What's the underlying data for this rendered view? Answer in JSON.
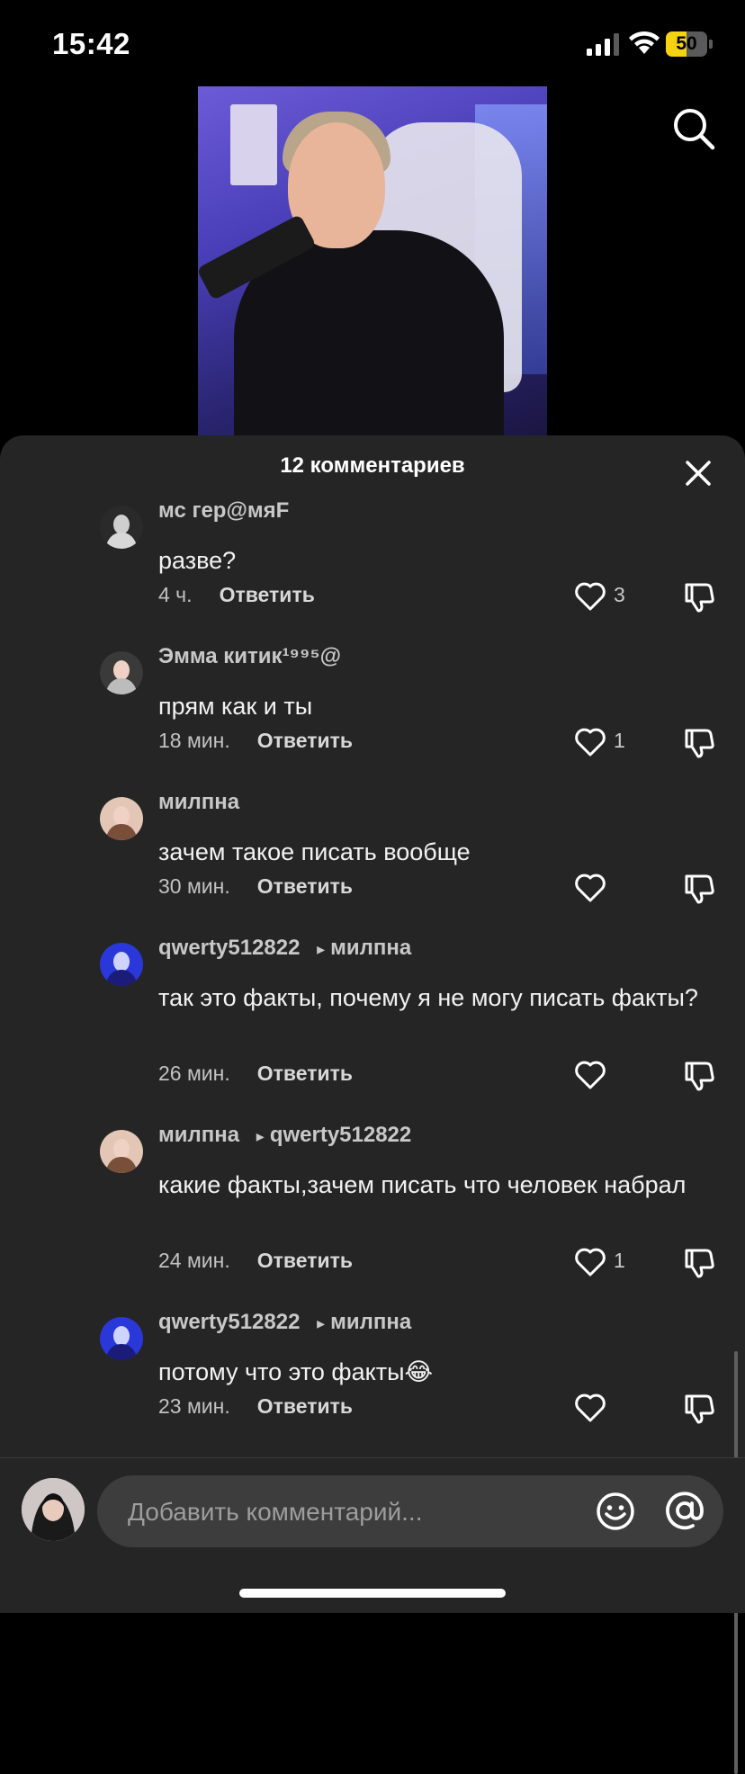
{
  "status_bar": {
    "time": "15:42",
    "battery": "50",
    "battery_level": 0.5
  },
  "sheet": {
    "title": "12 комментариев"
  },
  "comments": [
    {
      "username": "мс гер@мяF",
      "reply_to": "",
      "text": "разве?",
      "time": "4 ч.",
      "reply_label": "Ответить",
      "likes": "3"
    },
    {
      "username": "Эмма китик¹⁹⁹⁵@",
      "reply_to": "",
      "text": "прям как и ты",
      "time": "18 мин.",
      "reply_label": "Ответить",
      "likes": "1"
    },
    {
      "username": "милпна",
      "reply_to": "",
      "text": "зачем такое писать вообще",
      "time": "30 мин.",
      "reply_label": "Ответить",
      "likes": ""
    },
    {
      "username": "qwerty512822",
      "reply_to": "милпна",
      "text": "так это факты, почему я не могу писать факты?",
      "time": "26 мин.",
      "reply_label": "Ответить",
      "likes": ""
    },
    {
      "username": "милпна",
      "reply_to": "qwerty512822",
      "text": "какие факты,зачем писать что человек набрал",
      "time": "24 мин.",
      "reply_label": "Ответить",
      "likes": "1"
    },
    {
      "username": "qwerty512822",
      "reply_to": "милпна",
      "text": "потому что это факты😂",
      "time": "23 мин.",
      "reply_label": "Ответить",
      "likes": ""
    }
  ],
  "composer": {
    "placeholder": "Добавить комментарий..."
  }
}
